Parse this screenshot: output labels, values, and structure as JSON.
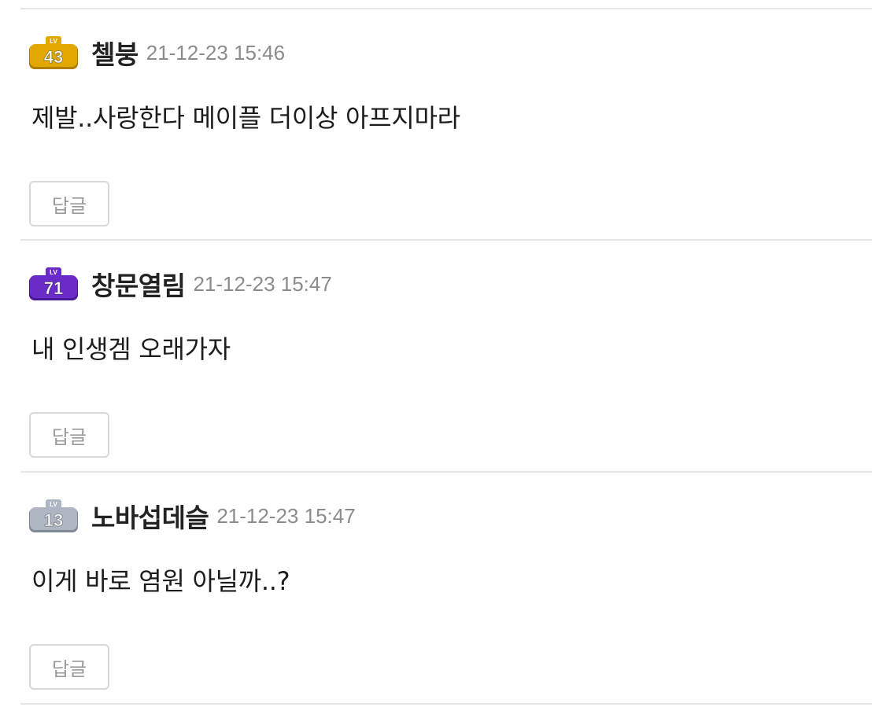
{
  "comments": [
    {
      "level": "43",
      "level_prefix": "LV",
      "badge_color": "#e0a800",
      "badge_shade": "#b37f00",
      "author": "첼붕",
      "timestamp": "21-12-23 15:46",
      "body": "제발..사랑한다 메이플 더이상 아프지마라",
      "reply_label": "답글"
    },
    {
      "level": "71",
      "level_prefix": "LV",
      "badge_color": "#6a2bc9",
      "badge_shade": "#4a1797",
      "author": "창문열림",
      "timestamp": "21-12-23 15:47",
      "body": "내 인생겜 오래가자",
      "reply_label": "답글"
    },
    {
      "level": "13",
      "level_prefix": "LV",
      "badge_color": "#aeb6c3",
      "badge_shade": "#7f8896",
      "author": "노바섭데슬",
      "timestamp": "21-12-23 15:47",
      "body": "이게 바로 염원 아닐까..?",
      "reply_label": "답글"
    }
  ]
}
